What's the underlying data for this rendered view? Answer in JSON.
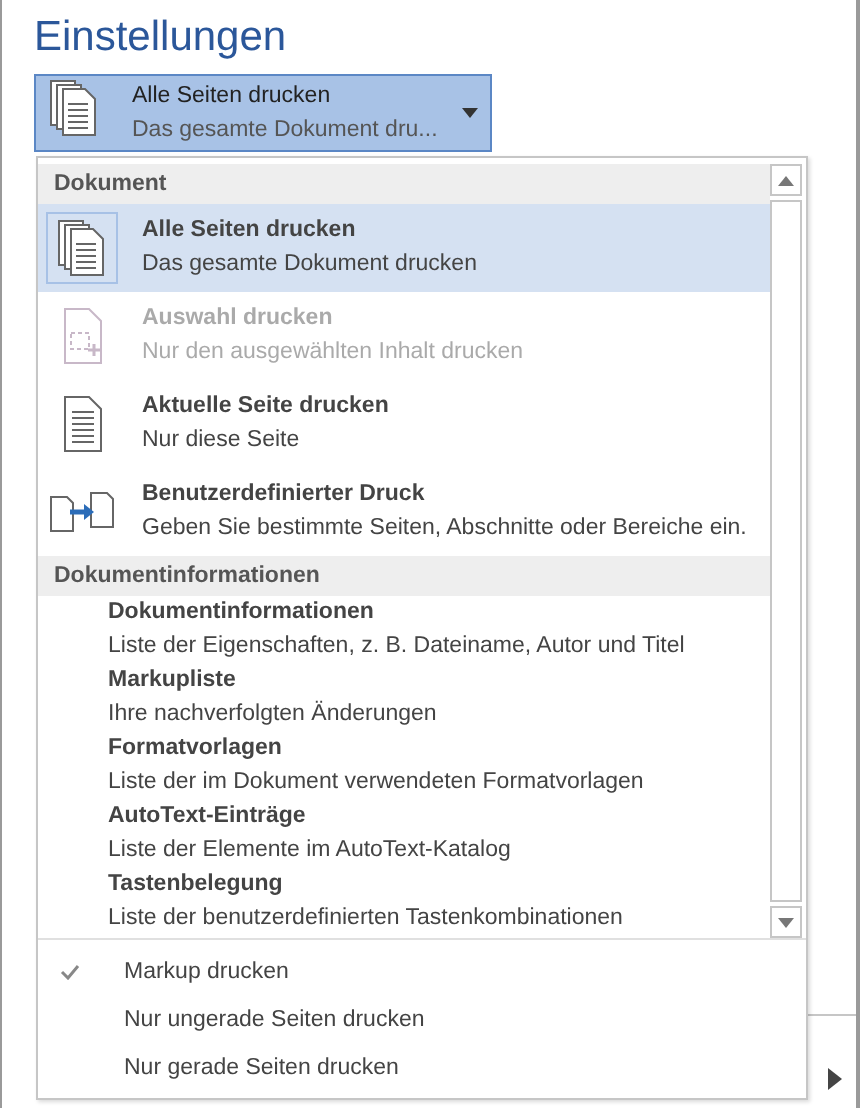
{
  "title": "Einstellungen",
  "print_range_button": {
    "label": "Alle Seiten drucken",
    "description": "Das gesamte Dokument dru...",
    "kind": "all-pages"
  },
  "menu": {
    "sections": [
      {
        "heading": "Dokument",
        "items": [
          {
            "kind": "all-pages",
            "label": "Alle Seiten drucken",
            "description": "Das gesamte Dokument drucken",
            "selected": true,
            "disabled": false
          },
          {
            "kind": "selection",
            "label": "Auswahl drucken",
            "description": "Nur den ausgewählten Inhalt drucken",
            "selected": false,
            "disabled": true
          },
          {
            "kind": "current-page",
            "label": "Aktuelle Seite drucken",
            "description": "Nur diese Seite",
            "selected": false,
            "disabled": false
          },
          {
            "kind": "custom",
            "label": "Benutzerdefinierter Druck",
            "description": "Geben Sie bestimmte Seiten, Abschnitte oder Bereiche ein.",
            "selected": false,
            "disabled": false
          }
        ]
      },
      {
        "heading": "Dokumentinformationen",
        "items": [
          {
            "kind": "text",
            "label": "Dokumentinformationen",
            "description": "Liste der Eigenschaften, z. B. Dateiname, Autor und Titel",
            "selected": false,
            "disabled": false
          },
          {
            "kind": "text",
            "label": "Markupliste",
            "description": "Ihre nachverfolgten Änderungen",
            "selected": false,
            "disabled": false
          },
          {
            "kind": "text",
            "label": "Formatvorlagen",
            "description": "Liste der im Dokument verwendeten Formatvorlagen",
            "selected": false,
            "disabled": false
          },
          {
            "kind": "text",
            "label": "AutoText-Einträge",
            "description": "Liste der Elemente im AutoText-Katalog",
            "selected": false,
            "disabled": false
          },
          {
            "kind": "text",
            "label": "Tastenbelegung",
            "description": "Liste der benutzerdefinierten Tastenkombinationen",
            "selected": false,
            "disabled": false
          }
        ]
      }
    ],
    "options": [
      {
        "label": "Markup drucken",
        "checked": true
      },
      {
        "label": "Nur ungerade Seiten drucken",
        "checked": false
      },
      {
        "label": "Nur gerade Seiten drucken",
        "checked": false
      }
    ]
  }
}
